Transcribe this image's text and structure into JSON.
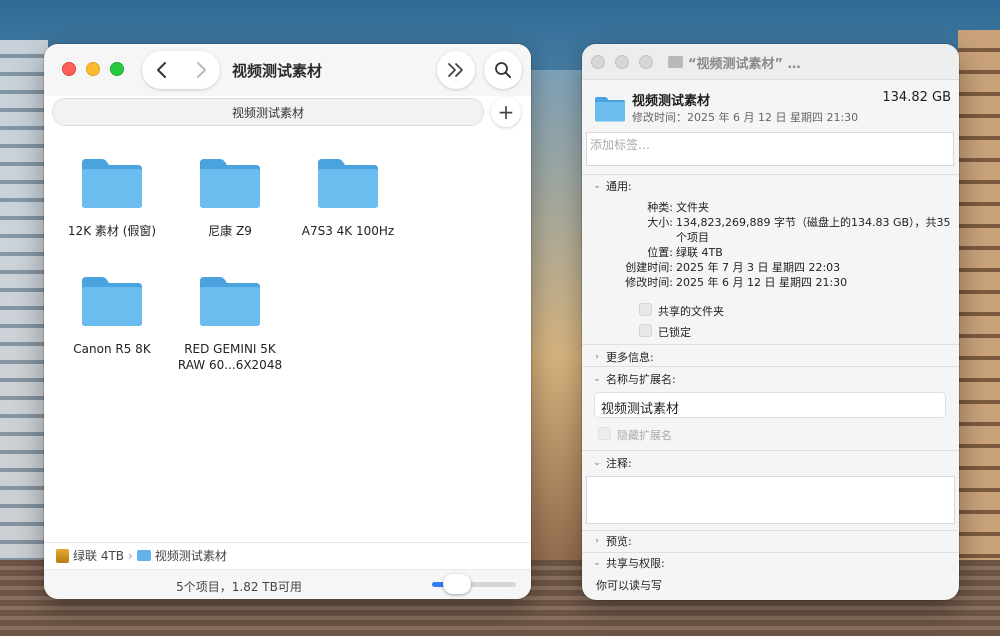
{
  "finder": {
    "title": "视频测试素材",
    "tab_label": "视频测试素材",
    "items": [
      {
        "name": "12K 素材 (假窗)"
      },
      {
        "name": "尼康 Z9"
      },
      {
        "name": "A7S3 4K 100Hz"
      },
      {
        "name": "Canon R5 8K"
      },
      {
        "name": "RED GEMINI 5K RAW 60...6X2048"
      }
    ],
    "path": {
      "drive": "绿联 4TB",
      "folder": "视频测试素材",
      "separator": "›"
    },
    "status": "5个项目，1.82 TB可用",
    "icon_size_level": 0.3,
    "folder_color": "#5fb3ea"
  },
  "info": {
    "window_title": "“视频测试素材” …",
    "name": "视频测试素材",
    "size": "134.82 GB",
    "modified_header": "修改时间：2025 年 6 月 12 日 星期四 21:30",
    "tags_placeholder": "添加标签…",
    "general": {
      "heading": "通用:",
      "rows": [
        {
          "key": "种类:",
          "value": "文件夹"
        },
        {
          "key": "大小:",
          "value": "134,823,269,889 字节（磁盘上的134.83 GB），共35"
        },
        {
          "key": "",
          "value": "个项目"
        },
        {
          "key": "位置:",
          "value": "绿联 4TB"
        },
        {
          "key": "创建时间:",
          "value": "2025 年 7 月 3 日 星期四 22:03"
        },
        {
          "key": "修改时间:",
          "value": "2025 年 6 月 12 日 星期四 21:30"
        }
      ],
      "shared_folder": "共享的文件夹",
      "locked": "已锁定"
    },
    "more_info": "更多信息:",
    "name_ext": {
      "heading": "名称与扩展名:",
      "value": "视频测试素材",
      "hide_ext": "隐藏扩展名"
    },
    "comments": "注释:",
    "preview": "预览:",
    "sharing": {
      "heading": "共享与权限:",
      "text": "你可以读与写"
    }
  }
}
